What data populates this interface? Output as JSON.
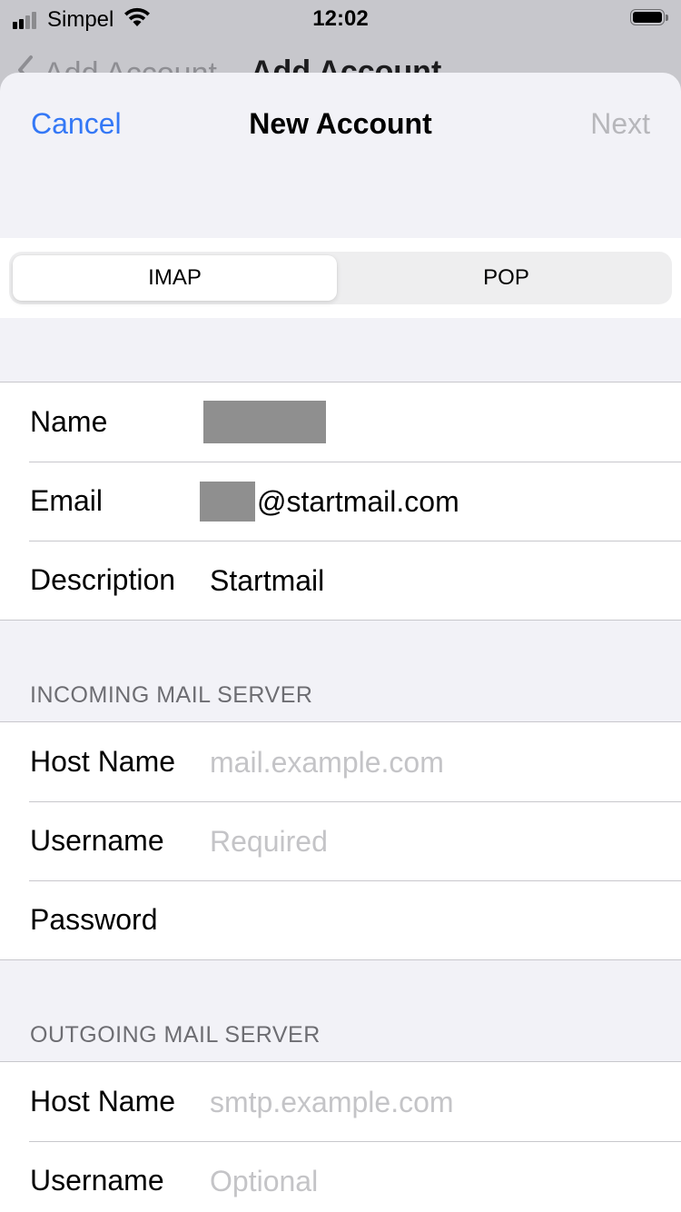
{
  "status_bar": {
    "carrier": "Simpel",
    "time": "12:02"
  },
  "background_nav": {
    "back_label": "Add Account",
    "title": "Add Account"
  },
  "navbar": {
    "cancel_label": "Cancel",
    "title": "New Account",
    "next_label": "Next"
  },
  "account_type": {
    "options": [
      "IMAP",
      "POP"
    ],
    "selected": "IMAP"
  },
  "account_info": {
    "name_label": "Name",
    "email_label": "Email",
    "email_domain": "@startmail.com",
    "description_label": "Description",
    "description_value": "Startmail"
  },
  "incoming": {
    "header": "INCOMING MAIL SERVER",
    "host_label": "Host Name",
    "host_placeholder": "mail.example.com",
    "username_label": "Username",
    "username_placeholder": "Required",
    "password_label": "Password"
  },
  "outgoing": {
    "header": "OUTGOING MAIL SERVER",
    "host_label": "Host Name",
    "host_placeholder": "smtp.example.com",
    "username_label": "Username",
    "username_placeholder": "Optional"
  },
  "colors": {
    "accent": "#3478f6",
    "disabled": "#b7b7bb",
    "placeholder": "#c4c4c7",
    "grouped_background": "#f2f2f7",
    "section_header": "#6d6d72"
  }
}
